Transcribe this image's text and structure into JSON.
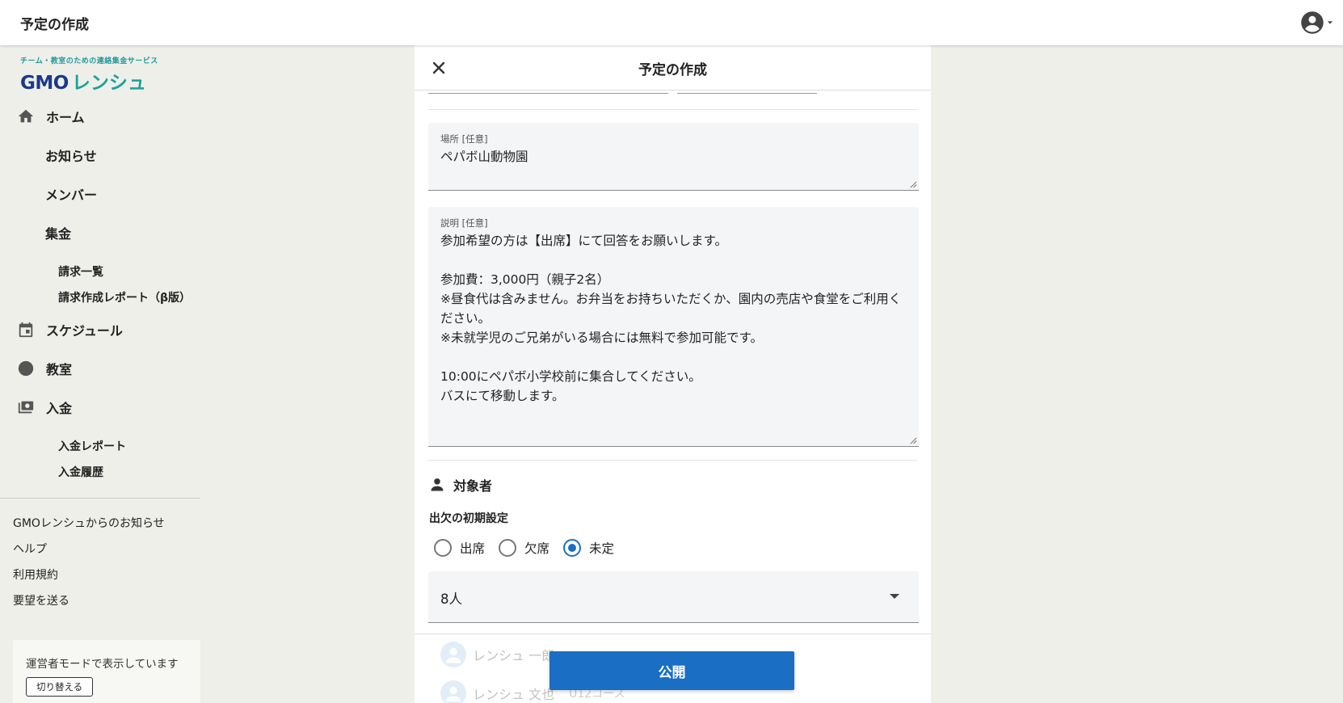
{
  "topbar": {
    "title": "予定の作成"
  },
  "logo": {
    "tagline": "チーム・教室のための連絡集金サービス",
    "gmo": "GMO",
    "name": "レンシュ"
  },
  "sidebar": {
    "home": "ホーム",
    "notice": "お知らせ",
    "member": "メンバー",
    "collect": "集金",
    "invoice_list": "請求一覧",
    "invoice_report": "請求作成レポート（β版）",
    "schedule": "スケジュール",
    "classroom": "教室",
    "deposit": "入金",
    "deposit_report": "入金レポート",
    "deposit_history": "入金履歴",
    "links": [
      "GMOレンシュからのお知らせ",
      "ヘルプ",
      "利用規約",
      "要望を送る"
    ],
    "mode_text": "運営者モードで表示しています",
    "mode_button": "切り替える"
  },
  "dialog": {
    "title": "予定の作成",
    "location_label": "場所 [任意]",
    "location_value": "ペパボ山動物園",
    "description_label": "説明 [任意]",
    "description_value": "参加希望の方は【出席】にて回答をお願いします。\n\n参加費：3,000円（親子2名）\n※昼食代は含みません。お弁当をお持ちいただくか、園内の売店や食堂をご利用ください。\n※未就学児のご兄弟がいる場合には無料で参加可能です。\n\n10:00にペパボ小学校前に集合してください。\nバスにて移動します。",
    "target_title": "対象者",
    "attendance_title": "出欠の初期設定",
    "radio_options": [
      "出席",
      "欠席",
      "未定"
    ],
    "selected_option": "未定",
    "select_value": "8人",
    "members": [
      {
        "name": "レンシュ 一郎",
        "course": ""
      },
      {
        "name": "レンシュ 文也",
        "course": "U12コース"
      }
    ],
    "publish_label": "公開"
  },
  "colors": {
    "primary": "#1a6fc4",
    "accent_brand": "#1aa39a",
    "sidebar_bg": "#efefea"
  }
}
